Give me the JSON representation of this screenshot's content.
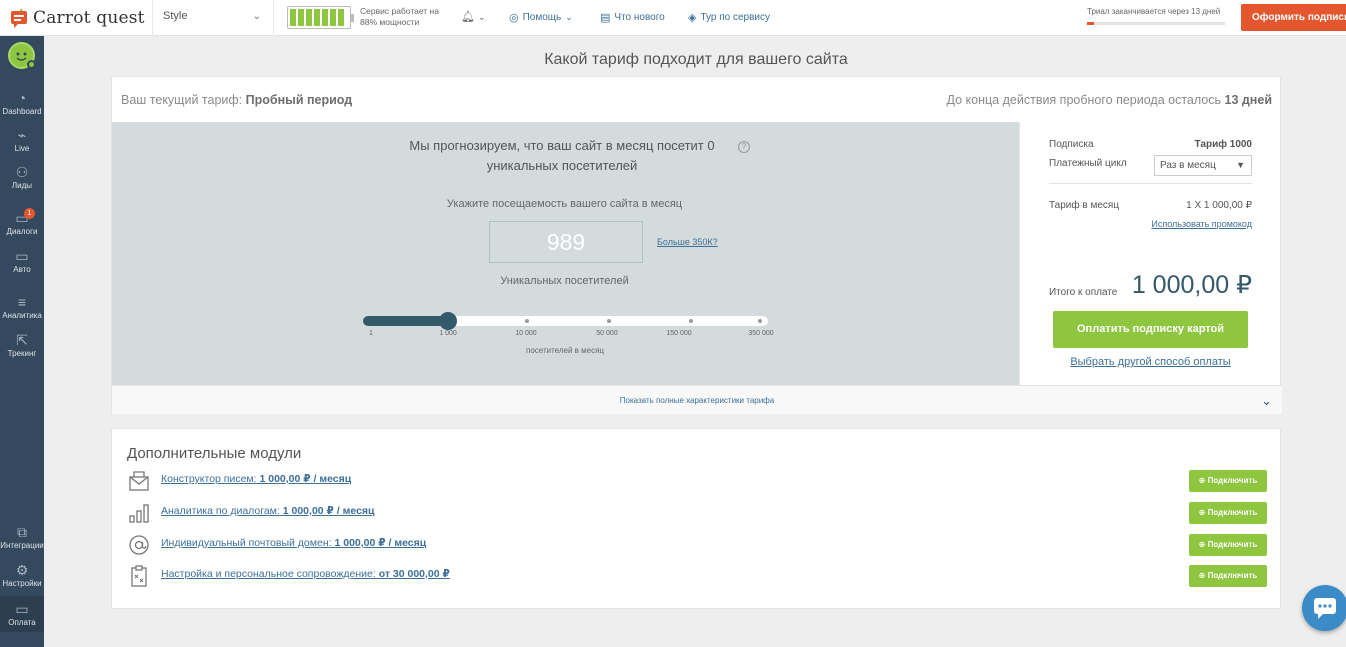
{
  "header": {
    "app_name": "Carrot quest",
    "project": "Style",
    "service_status": [
      "Сервис работает на",
      "88% мощности"
    ],
    "help": "Помощь",
    "whats_new": "Что нового",
    "tour": "Тур по сервису",
    "trial_text": "Триал заканчивается через 13 дней",
    "trial_progress": 0.05,
    "subscribe_button": "Оформить подписку",
    "battery_level": 0.88
  },
  "sidebar": {
    "items": [
      {
        "label": "Dashboard",
        "icon": "gauge-icon"
      },
      {
        "label": "Live",
        "icon": "pulse-icon"
      },
      {
        "label": "Лиды",
        "icon": "users-icon"
      },
      {
        "label": "Диалоги",
        "icon": "chat-icon",
        "badge": "1"
      },
      {
        "label": "Авто",
        "icon": "auto-message-icon"
      },
      {
        "label": "Аналитика",
        "icon": "analytics-icon"
      },
      {
        "label": "Трекинг",
        "icon": "cursor-icon"
      },
      {
        "label": "Интеграции",
        "icon": "puzzle-icon"
      },
      {
        "label": "Настройки",
        "icon": "gear-icon"
      },
      {
        "label": "Оплата",
        "icon": "card-icon"
      }
    ]
  },
  "main": {
    "title": "Какой тариф подходит для вашего сайта",
    "current_plan_label": "Ваш текущий тариф:",
    "current_plan": "Пробный период",
    "days_left_label": "До конца действия пробного периода осталось",
    "days_left": "13 дней",
    "forecast": "Мы прогнозируем, что ваш сайт в месяц посетит 0 уникальных посетителей",
    "help_mark": "?",
    "visits_label": "Укажите посещаемость вашего сайта в месяц",
    "visits_value": "989",
    "more_350k": "Больше 350К?",
    "unique_label": "Уникальных посетителей",
    "slider_ticks": [
      "1",
      "1 000",
      "10 000",
      "50 000",
      "150 000",
      "350 000"
    ],
    "slider_position": 0.21,
    "per_month": "посетителей в месяц",
    "show_full": "Показать полные характеристики тарифа"
  },
  "summary": {
    "subscription_label": "Подписка",
    "subscription_value": "Тариф 1000",
    "cycle_label": "Платежный цикл",
    "cycle_value": "Раз в месяц",
    "price_label": "Тариф в месяц",
    "price_value": "1 X 1 000,00 ₽",
    "promo": "Использовать промокод",
    "total_label": "Итого к оплате",
    "total_value": "1 000,00 ₽",
    "pay_button": "Оплатить подписку картой",
    "other_pay": "Выбрать другой способ оплаты"
  },
  "modules": {
    "title": "Дополнительные модули",
    "items": [
      {
        "name": "Конструктор писем:",
        "price": "1 000,00 ₽ / месяц",
        "button": "Подключить",
        "icon": "email-builder-icon"
      },
      {
        "name": "Аналитика по диалогам:",
        "price": "1 000,00 ₽ / месяц",
        "button": "Подключить",
        "icon": "bar-chart-icon"
      },
      {
        "name": "Индивидуальный почтовый домен:",
        "price": "1 000,00 ₽ / месяц",
        "button": "Подключить",
        "icon": "at-sign-icon"
      },
      {
        "name": "Настройка и персональное сопровождение:",
        "price": "от 30 000,00 ₽",
        "button": "Подключить",
        "icon": "clipboard-icon"
      }
    ]
  },
  "colors": {
    "accent_orange": "#e4572e",
    "accent_green": "#8ec63f",
    "sidebar": "#34495e",
    "link": "#3e6f96",
    "slider": "#34596b"
  }
}
